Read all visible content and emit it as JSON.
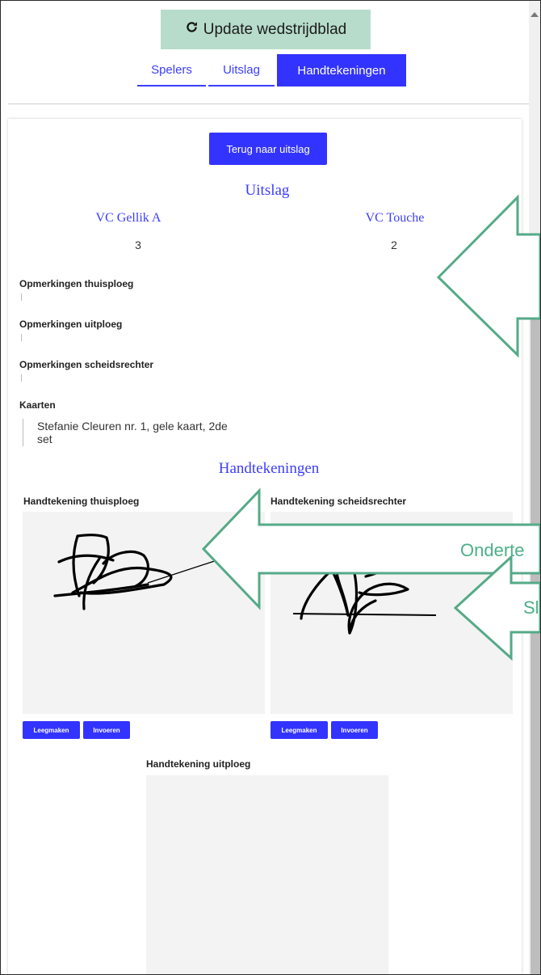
{
  "header": {
    "update_label": "Update wedstrijdblad",
    "tabs": [
      {
        "label": "Spelers",
        "active": false
      },
      {
        "label": "Uitslag",
        "active": false
      },
      {
        "label": "Handtekeningen",
        "active": true
      }
    ]
  },
  "uitslag": {
    "back_label": "Terug naar uitslag",
    "title": "Uitslag",
    "home_team": "VC Gellik A",
    "away_team": "VC Touche",
    "home_score": "3",
    "away_score": "2"
  },
  "remarks": {
    "home_label": "Opmerkingen thuisploeg",
    "away_label": "Opmerkingen uitploeg",
    "referee_label": "Opmerkingen scheidsrechter",
    "cards_label": "Kaarten",
    "cards_value": "Stefanie Cleuren nr. 1, gele kaart, 2de set"
  },
  "signatures": {
    "title": "Handtekeningen",
    "home_label": "Handtekening thuisploeg",
    "referee_label": "Handtekening scheidsrechter",
    "away_label": "Handtekening uitploeg",
    "clear_label": "Leegmaken",
    "submit_label": "Invoeren"
  },
  "annotations": {
    "arrow2_text": "Onderte",
    "arrow3_text": "Sl"
  },
  "colors": {
    "accent": "#3333ff",
    "update_button": "#b7dccb",
    "annotation_green": "#4caf8a"
  }
}
